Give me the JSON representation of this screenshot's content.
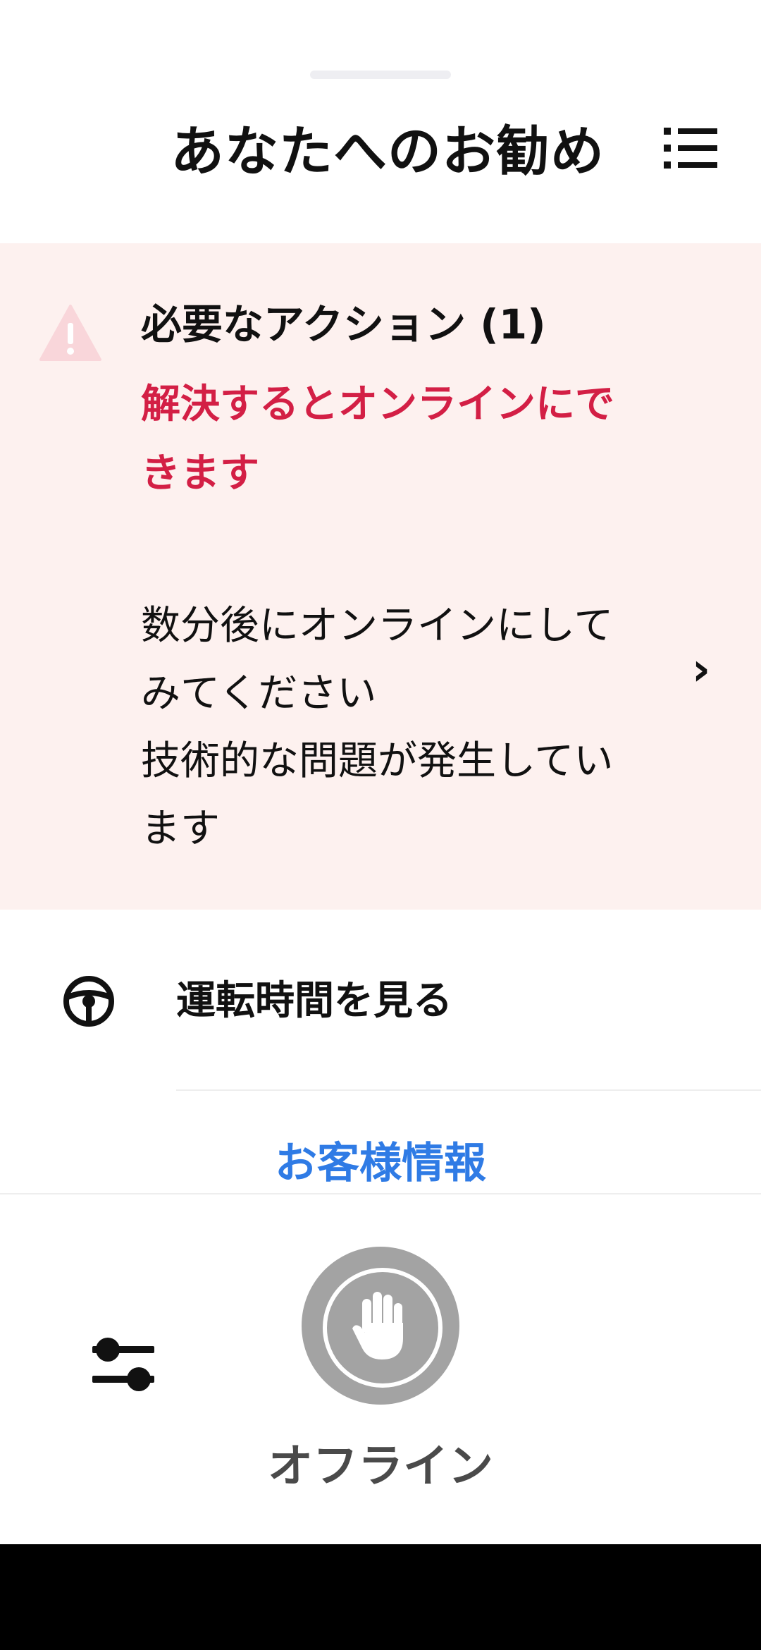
{
  "header": {
    "title": "あなたへのお勧め",
    "menu_icon": "list-icon"
  },
  "action_required": {
    "title": "必要なアクション (1)",
    "subtitle": "解決するとオンラインにできます",
    "warning_icon": "warning-triangle-icon",
    "accent_color": "#d31f45",
    "background_color": "#fdf1ef",
    "item": {
      "line1": "数分後にオンラインにしてみてください",
      "line2": "技術的な問題が発生しています",
      "chevron": "›"
    }
  },
  "drive_time": {
    "label": "運転時間を見る",
    "icon": "steering-wheel-icon"
  },
  "customer_info": {
    "label": "お客様情報",
    "color": "#2f7be5"
  },
  "bottom_bar": {
    "settings_icon": "sliders-icon",
    "status_icon": "hand-stop-icon",
    "status_label": "オフライン",
    "status_color": "#a3a3a3"
  }
}
